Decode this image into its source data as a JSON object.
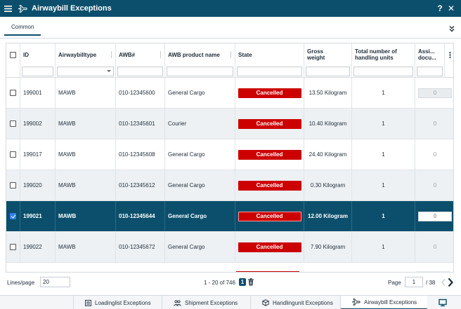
{
  "window": {
    "title": "Airwaybill Exceptions",
    "help_label": "?",
    "close_label": "✕"
  },
  "icons": {
    "menu": "hamburger-icon",
    "title": "airplane-icon",
    "collapse": "double-chevron-down-icon",
    "delete": "trash-icon",
    "next": "chevron-right-icon",
    "prev": "chevron-left-icon",
    "screen": "monitor-icon"
  },
  "tabs": [
    {
      "label": "Common",
      "active": true
    }
  ],
  "grid": {
    "columns": [
      {
        "key": "select",
        "label": ""
      },
      {
        "key": "id",
        "label": "ID"
      },
      {
        "key": "type",
        "label": "Airwaybilltype"
      },
      {
        "key": "awb",
        "label": "AWB#"
      },
      {
        "key": "product",
        "label": "AWB product name"
      },
      {
        "key": "state",
        "label": "State"
      },
      {
        "key": "weight",
        "label": "Gross weight"
      },
      {
        "key": "units",
        "label": "Total number of handling units"
      },
      {
        "key": "assigned",
        "label": "Assi... docu..."
      }
    ],
    "rows": [
      {
        "id": "199001",
        "type": "MAWB",
        "awb": "010-12345600",
        "product": "General Cargo",
        "state": "Cancelled",
        "weight": "13.50 Kilogram",
        "units": "1",
        "assigned": "0",
        "selected": false
      },
      {
        "id": "199002",
        "type": "MAWB",
        "awb": "010-12345601",
        "product": "Courier",
        "state": "Cancelled",
        "weight": "10.40 Kilogram",
        "units": "1",
        "assigned": "0",
        "selected": false
      },
      {
        "id": "199017",
        "type": "MAWB",
        "awb": "010-12345608",
        "product": "General Cargo",
        "state": "Cancelled",
        "weight": "24.40 Kilogram",
        "units": "1",
        "assigned": "0",
        "selected": false
      },
      {
        "id": "199020",
        "type": "MAWB",
        "awb": "010-12345612",
        "product": "General Cargo",
        "state": "Cancelled",
        "weight": "0.30 Kilogram",
        "units": "1",
        "assigned": "0",
        "selected": false
      },
      {
        "id": "199021",
        "type": "MAWB",
        "awb": "010-12345644",
        "product": "General Cargo",
        "state": "Cancelled",
        "weight": "12.00 Kilogram",
        "units": "1",
        "assigned": "0",
        "selected": true
      },
      {
        "id": "199022",
        "type": "MAWB",
        "awb": "010-12345672",
        "product": "General Cargo",
        "state": "Cancelled",
        "weight": "7.90 Kilogram",
        "units": "1",
        "assigned": "0",
        "selected": false
      }
    ]
  },
  "footer": {
    "lines_label": "Lines/page",
    "lines_value": "20",
    "range_text": "1 - 20 of 746",
    "selected_count": "1",
    "page_label": "Page",
    "page_value": "1",
    "page_total": "/ 38"
  },
  "taskbar": [
    {
      "label": "Loadinglist Exceptions",
      "icon": "list-icon",
      "active": false
    },
    {
      "label": "Shipment Exceptions",
      "icon": "people-icon",
      "active": false
    },
    {
      "label": "Handlingunit Exceptions",
      "icon": "box-icon",
      "active": false
    },
    {
      "label": "Airwaybill Exceptions",
      "icon": "airplane-icon",
      "active": true
    }
  ],
  "colors": {
    "primary": "#0b4f6c",
    "cancelled": "#cc0000",
    "row_alt": "#edf1f4"
  }
}
